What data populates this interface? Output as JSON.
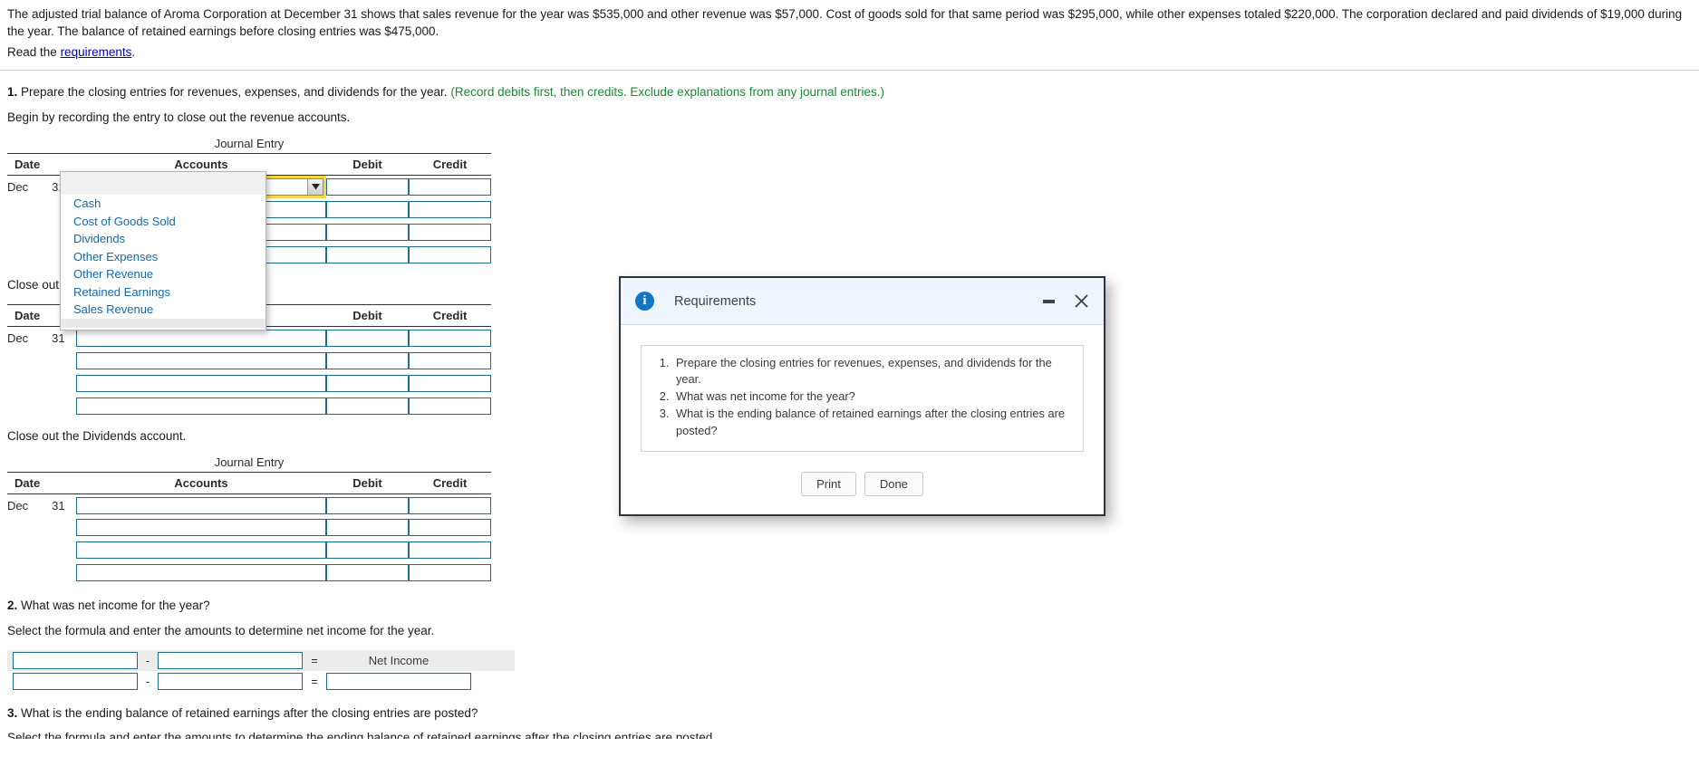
{
  "problem": {
    "paragraph": "The adjusted trial balance of Aroma Corporation at December 31 shows that sales revenue for the year was $535,000 and other revenue was $57,000. Cost of goods sold for that same period was $295,000, while other expenses totaled $220,000. The corporation declared and paid dividends of $19,000 during the year. The balance of retained earnings before closing entries was $475,000.",
    "read_prefix": "Read the",
    "read_link": "requirements",
    "read_suffix": "."
  },
  "question1": {
    "number": "1.",
    "text": "Prepare the closing entries for revenues, expenses, and dividends for the year.",
    "hint": "(Record debits first, then credits. Exclude explanations from any journal entries.)",
    "instruction_revenue": "Begin by recording the entry to close out the revenue accounts.",
    "instruction_expense": "Close out the expense accounts.",
    "instruction_dividends": "Close out the Dividends account."
  },
  "journal": {
    "title": "Journal Entry",
    "columns": [
      "Date",
      "Accounts",
      "Debit",
      "Credit"
    ],
    "date_month": "Dec",
    "date_day": "31",
    "row_count": 4
  },
  "account_dropdown": {
    "selected": "",
    "options": [
      "Cash",
      "Cost of Goods Sold",
      "Dividends",
      "Other Expenses",
      "Other Revenue",
      "Retained Earnings",
      "Sales Revenue"
    ]
  },
  "question2": {
    "number": "2.",
    "text": "What was net income for the year?",
    "instruction": "Select the formula and enter the amounts to determine net income for the year.",
    "operator_minus": "-",
    "operator_equals": "=",
    "result_label": "Net Income",
    "field1_value": "",
    "field2_value": "",
    "field3_value": "",
    "field4_value": "",
    "field5_value": ""
  },
  "question3": {
    "number": "3.",
    "text": "What is the ending balance of retained earnings after the closing entries are posted?"
  },
  "dialog": {
    "title": "Requirements",
    "icon": "info-icon",
    "items": [
      "Prepare the closing entries for revenues, expenses, and dividends for the year.",
      "What was net income for the year?",
      "What is the ending balance of retained earnings after the closing entries are posted?"
    ],
    "print_label": "Print",
    "done_label": "Done",
    "minimize_label": "",
    "close_label": ""
  },
  "colors": {
    "link": "#0000cc",
    "hint_green": "#1a8a36",
    "field_border": "#1d6e8a",
    "focus_yellow": "#f5d54a",
    "dialog_header": "#eef5fd",
    "info_blue": "#1176c4",
    "option_blue": "#1769aa"
  }
}
